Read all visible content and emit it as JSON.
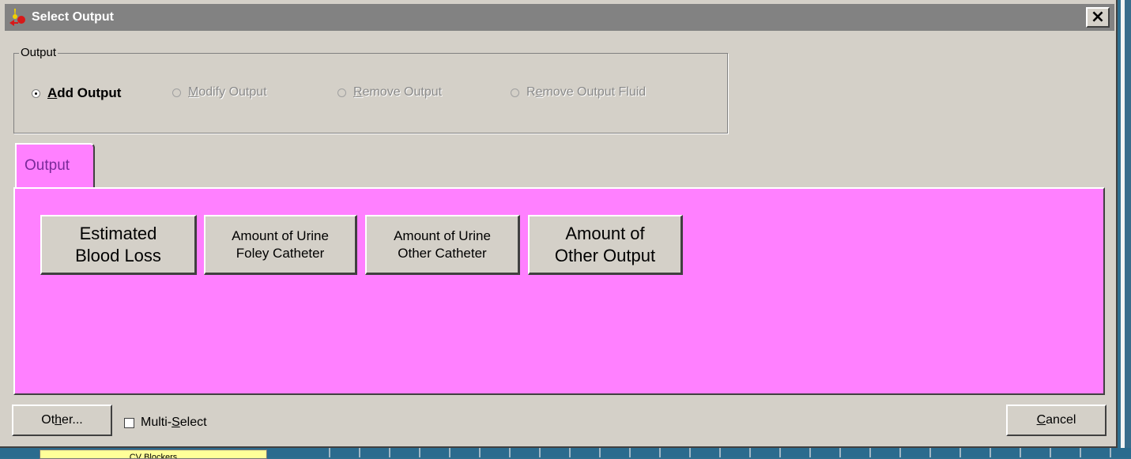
{
  "window": {
    "title": "Select Output",
    "close_label": "×"
  },
  "group": {
    "legend": "Output",
    "options": [
      {
        "label": "Add Output",
        "accel": "A",
        "rest": "dd Output",
        "selected": true,
        "enabled": true
      },
      {
        "label": "Modify Output",
        "accel": "M",
        "rest": "odify Output",
        "selected": false,
        "enabled": false
      },
      {
        "label": "Remove Output",
        "accel": "R",
        "rest": "emove Output",
        "selected": false,
        "enabled": false
      },
      {
        "label": "Remove Output Fluid",
        "pre": "R",
        "accel": "e",
        "rest": "move Output Fluid",
        "selected": false,
        "enabled": false
      }
    ]
  },
  "tabs": [
    {
      "label": "Output",
      "color": "#ff80ff"
    }
  ],
  "output_buttons": [
    {
      "label": "Estimated\nBlood Loss"
    },
    {
      "label": "Amount of Urine\nFoley Catheter"
    },
    {
      "label": "Amount of Urine\nOther Catheter"
    },
    {
      "label": "Amount of\nOther Output"
    }
  ],
  "footer": {
    "other_pre": "Ot",
    "other_accel": "h",
    "other_rest": "er...",
    "multiselect_pre": "Multi-",
    "multiselect_accel": "S",
    "multiselect_rest": "elect",
    "multiselect_checked": false,
    "cancel_accel": "C",
    "cancel_rest": "ancel"
  },
  "background": {
    "list_item": "CV Blockers"
  }
}
